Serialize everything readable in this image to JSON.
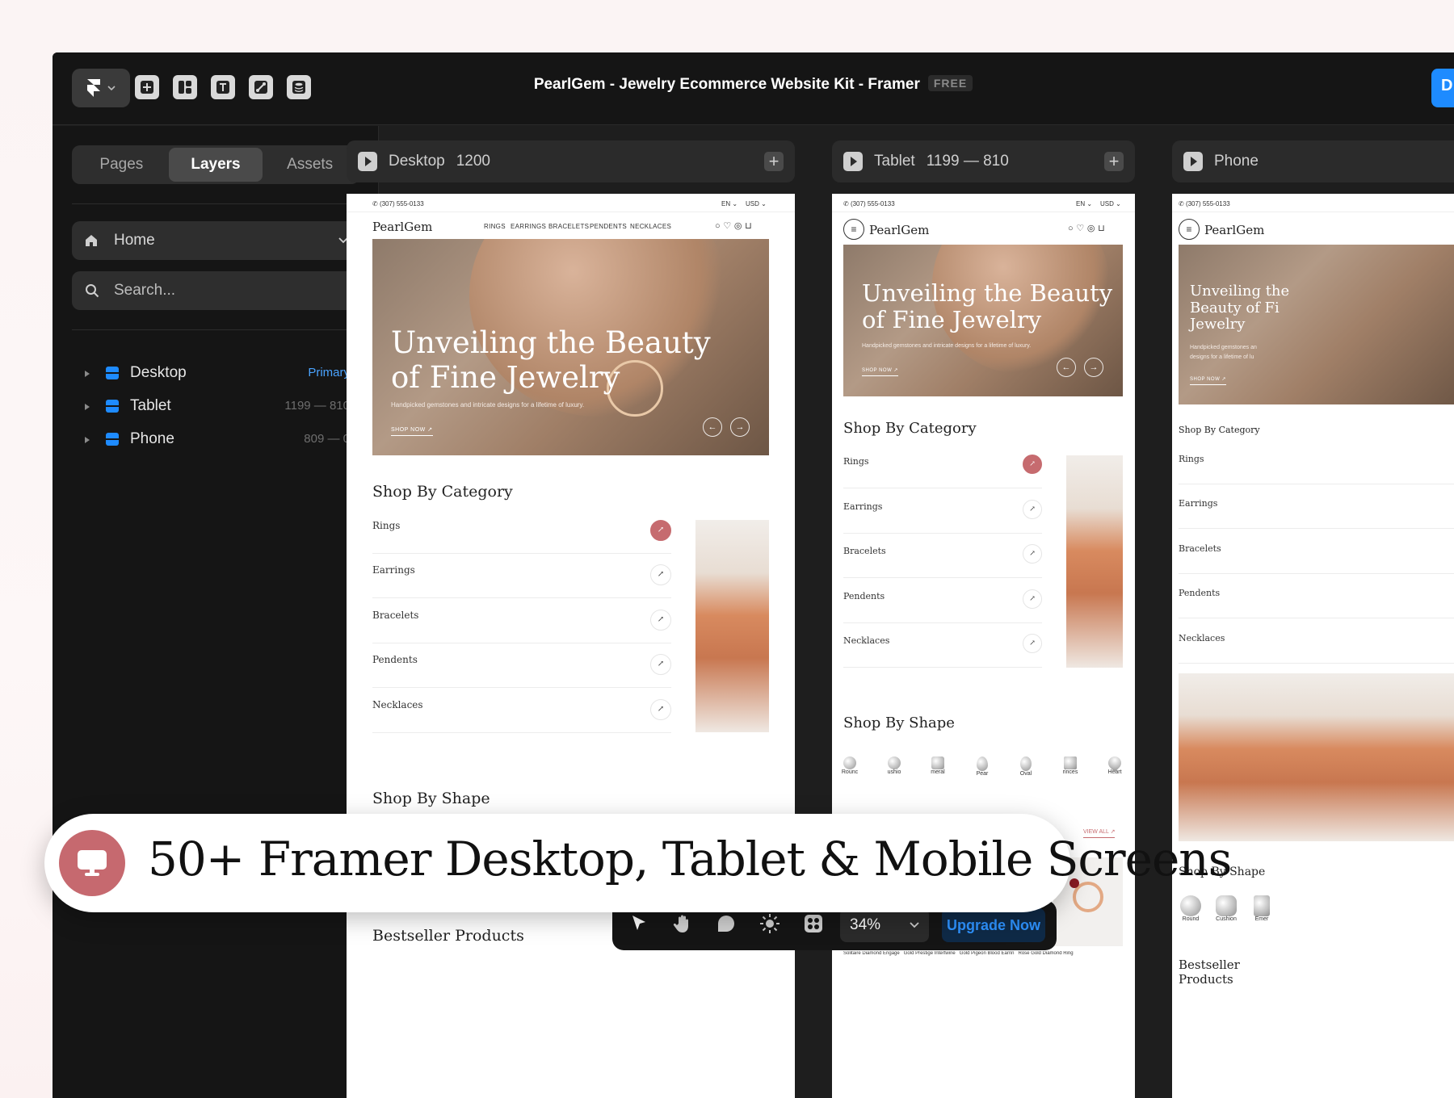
{
  "window": {
    "title": "PearlGem - Jewelry Ecommerce Website Kit - Framer",
    "badge": "FREE",
    "publish_label": "D"
  },
  "toolbar": {
    "icons": [
      "framer-logo-icon",
      "plus-icon",
      "layout-icon",
      "text-icon",
      "vector-pen-icon",
      "database-icon"
    ]
  },
  "sidebar": {
    "tabs": [
      "Pages",
      "Layers",
      "Assets"
    ],
    "active_tab": "Layers",
    "page_select": "Home",
    "search_placeholder": "Search...",
    "layers": [
      {
        "name": "Desktop",
        "meta": "Primary"
      },
      {
        "name": "Tablet",
        "meta": "1199 — 810"
      },
      {
        "name": "Phone",
        "meta": "809 — 0"
      }
    ]
  },
  "frames": {
    "desktop": {
      "label": "Desktop",
      "dim": "1200"
    },
    "tablet": {
      "label": "Tablet",
      "dim": "1199 — 810"
    },
    "phone": {
      "label": "Phone"
    }
  },
  "site": {
    "phone": "(307) 555-0133",
    "lang": "EN",
    "currency": "USD",
    "brand": "PearlGem",
    "nav": [
      "RINGS",
      "EARRINGS",
      "BRACELETS",
      "PENDENTS",
      "NECKLACES"
    ],
    "hero_title": "Unveiling the Beauty of Fine Jewelry",
    "hero_line1": "Unveiling the Beauty",
    "hero_line2": "of Fine Jewelry",
    "hero_subtitle": "Handpicked gemstones and intricate designs for a lifetime of luxury.",
    "phone_hero_1": "Unveiling the",
    "phone_hero_2": "Beauty of Fi",
    "phone_hero_3": "Jewelry",
    "phone_sub_1": "Handpicked gemstones an",
    "phone_sub_2": "designs for a lifetime of lu",
    "shop_now": "SHOP NOW",
    "shop_by_category": "Shop By Category",
    "categories": [
      "Rings",
      "Earrings",
      "Bracelets",
      "Pendents",
      "Necklaces"
    ],
    "shop_by_shape": "Shop By Shape",
    "shapes_tablet": [
      "Rounc",
      "ushio",
      "meral",
      "Pear",
      "Oval",
      "rinces",
      "Heart"
    ],
    "shapes_phone": [
      "Round",
      "Cushion",
      "Emer"
    ],
    "view_all": "VIEW ALL",
    "bestseller": "Bestseller Products",
    "bestseller_l1": "Bestseller",
    "bestseller_l2": "Products",
    "products": [
      "Solitaire Diamond Engage",
      "Gold Prestige Intertwine",
      "Gold Pigeon Blood Earrin",
      "Rose Gold Diamond Ring"
    ]
  },
  "banner": {
    "text": "50+ Framer Desktop, Tablet & Mobile Screens"
  },
  "bottom_toolbar": {
    "tools": [
      "cursor-icon",
      "hand-icon",
      "comment-icon",
      "sun-icon",
      "plugins-icon"
    ],
    "zoom": "34%",
    "upgrade_label": "Upgrade Now"
  },
  "colors": {
    "accent": "#1e8bff",
    "brand_rose": "#c66b6f",
    "canvas": "#1e1e1e"
  }
}
